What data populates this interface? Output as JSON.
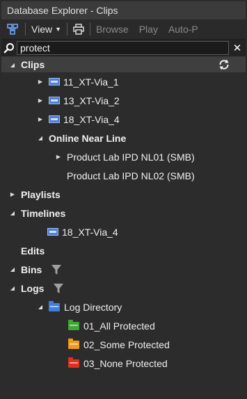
{
  "window": {
    "title": "Database Explorer - Clips"
  },
  "toolbar": {
    "view_label": "View",
    "browse_label": "Browse",
    "play_label": "Play",
    "autoplay_label": "Auto-P"
  },
  "search": {
    "value": "protect"
  },
  "tree": {
    "clips": {
      "label": "Clips",
      "items": [
        {
          "label": "11_XT-Via_1"
        },
        {
          "label": "13_XT-Via_2"
        },
        {
          "label": "18_XT-Via_4"
        }
      ],
      "online_near_line": {
        "label": "Online Near Line",
        "items": [
          {
            "label": "Product Lab IPD NL01 (SMB)"
          },
          {
            "label": "Product Lab IPD NL02 (SMB)"
          }
        ]
      }
    },
    "playlists": {
      "label": "Playlists"
    },
    "timelines": {
      "label": "Timelines",
      "items": [
        {
          "label": "18_XT-Via_4"
        }
      ]
    },
    "edits": {
      "label": "Edits"
    },
    "bins": {
      "label": "Bins"
    },
    "logs": {
      "label": "Logs",
      "log_directory": {
        "label": "Log Directory",
        "folders": [
          {
            "label": "01_All Protected",
            "color": "#3fa535"
          },
          {
            "label": "02_Some Protected",
            "color": "#f29a1a"
          },
          {
            "label": "03_None Protected",
            "color": "#e0301e"
          }
        ]
      }
    }
  },
  "colors": {
    "accent_blue": "#6ea8ff",
    "header_bg": "#3f3f3f",
    "panel_bg": "#2c2c2c"
  }
}
